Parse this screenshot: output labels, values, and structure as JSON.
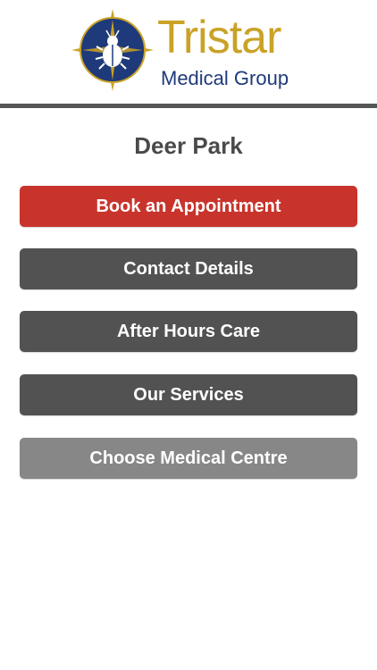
{
  "header": {
    "logo_word": "Tristar",
    "logo_sub": "Medical Group",
    "emblem_icon": "scarab-compass-emblem-icon"
  },
  "page": {
    "title": "Deer Park"
  },
  "buttons": {
    "book": "Book an Appointment",
    "contact": "Contact Details",
    "after_hours": "After Hours Care",
    "services": "Our Services",
    "choose_centre": "Choose Medical Centre"
  },
  "colors": {
    "logo_gold": "#c9a227",
    "logo_blue": "#1f3a7a",
    "primary_red": "#c8342c",
    "button_dark": "#525252",
    "button_light": "#878787",
    "divider": "#555555"
  }
}
